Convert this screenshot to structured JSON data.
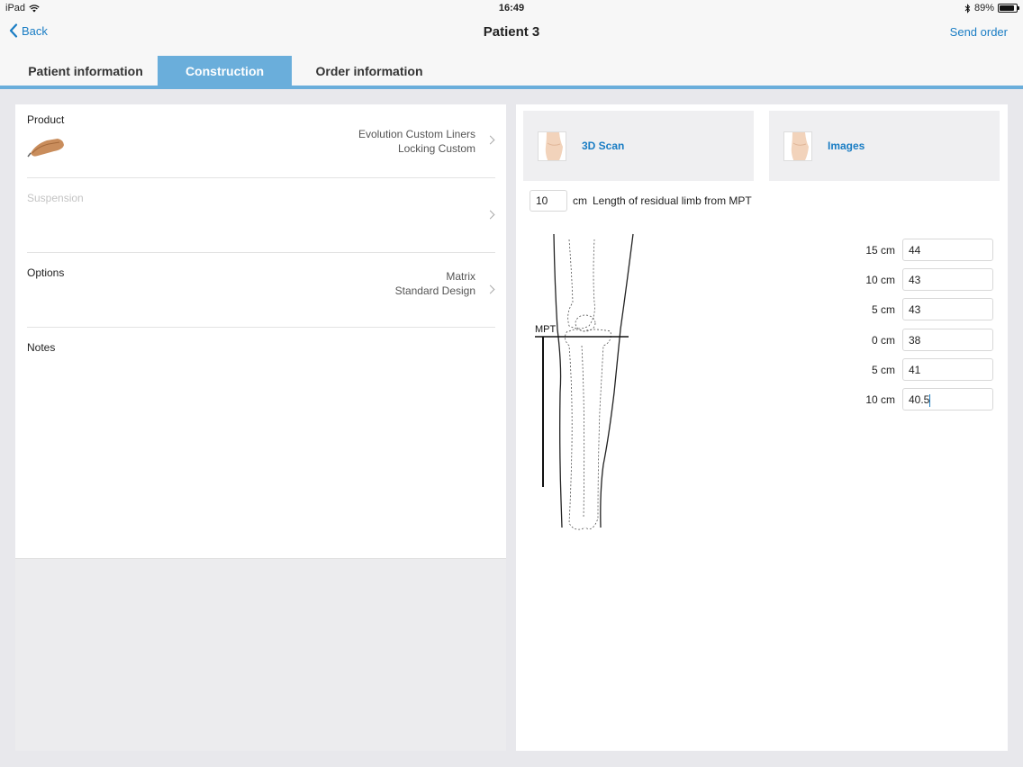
{
  "status": {
    "device": "iPad",
    "time": "16:49",
    "battery": "89%",
    "battery_level": 0.89
  },
  "nav": {
    "back": "Back",
    "title": "Patient 3",
    "send": "Send order"
  },
  "tabs": [
    "Patient information",
    "Construction",
    "Order information"
  ],
  "left": {
    "product": {
      "label": "Product",
      "line1": "Evolution Custom Liners",
      "line2": "Locking Custom"
    },
    "suspension": {
      "label": "Suspension"
    },
    "options": {
      "label": "Options",
      "line1": "Matrix",
      "line2": "Standard Design"
    },
    "notes": {
      "label": "Notes"
    }
  },
  "right": {
    "scan_label": "3D Scan",
    "images_label": "Images",
    "length_value": "10",
    "length_unit": "cm",
    "length_label": "Length of residual limb from MPT",
    "mpt_label": "MPT",
    "measurements": [
      {
        "label": "15 cm",
        "value": "44"
      },
      {
        "label": "10 cm",
        "value": "43"
      },
      {
        "label": "5 cm",
        "value": "43"
      },
      {
        "label": "0 cm",
        "value": "38"
      },
      {
        "label": "5 cm",
        "value": "41"
      },
      {
        "label": "10 cm",
        "value": "40.5"
      }
    ]
  },
  "colors": {
    "accent": "#1a7dc4",
    "tab_active": "#6aaedb"
  }
}
